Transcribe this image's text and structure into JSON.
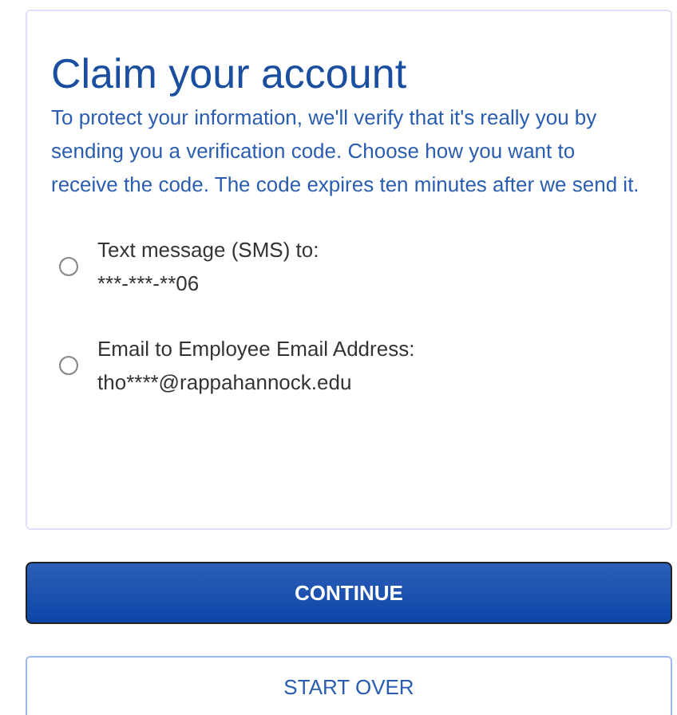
{
  "title": "Claim your account",
  "description": "To protect your information, we'll verify that it's really you by sending you a verification code. Choose how you want to receive the code. The code expires ten minutes after we send it.",
  "options": [
    {
      "label": "Text message (SMS) to:",
      "value": "***-***-**06",
      "selected": false
    },
    {
      "label": "Email to Employee Email Address:",
      "value": "tho****@rappahannock.edu",
      "selected": false
    }
  ],
  "buttons": [
    {
      "label": "CONTINUE",
      "kind": "primary"
    },
    {
      "label": "START OVER",
      "kind": "secondary"
    }
  ]
}
